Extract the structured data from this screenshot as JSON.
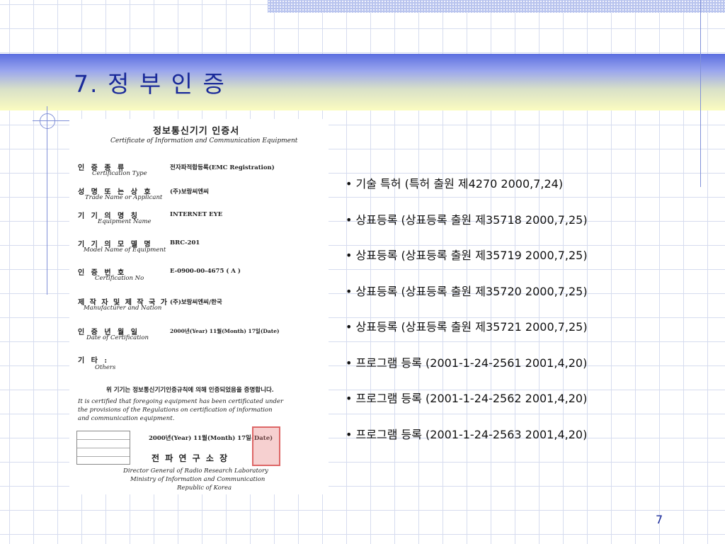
{
  "slide": {
    "title": "7. 정 부 인 증",
    "page_number": "7",
    "bullet": "•",
    "items": [
      "기술 특허 (특허 출원 제4270  2000,7,24)",
      "상표등록 (상표등록 출원 제35718  2000,7,25)",
      "상표등록 (상표등록 출원 제35719  2000,7,25)",
      "상표등록 (상표등록 출원 제35720  2000,7,25)",
      "상표등록 (상표등록 출원 제35721  2000,7,25)",
      "프로그램 등록 (2001-1-24-2561  2001,4,20)",
      "프로그램 등록 (2001-1-24-2562  2001,4,20)",
      "프로그램 등록 (2001-1-24-2563  2001,4,20)"
    ]
  },
  "certificate": {
    "title_ko": "정보통신기기 인증서",
    "title_en": "Certificate of Information and Communication Equipment",
    "rows": [
      {
        "ko": "인  증  종  류",
        "en": "Certification Type",
        "value": "전자파적합등록(EMC Registration)"
      },
      {
        "ko": "성 명 또 는 상 호",
        "en": "Trade Name or Applicant",
        "value": "(주)보랑씨엔씨"
      },
      {
        "ko": "기  기  의  명  칭",
        "en": "Equipment Name",
        "value": "INTERNET EYE"
      },
      {
        "ko": "기 기 의 모 델 명",
        "en": "Model Name of Equipment",
        "value": "BRC-201"
      },
      {
        "ko": "인  증  번  호",
        "en": "Certification No",
        "value": "E-0900-00-4675  ( A )"
      },
      {
        "ko": "제 작 자 및 제 작 국 가",
        "en": "Manufacturer and Nation",
        "value": "(주)보랑씨엔씨/한국"
      },
      {
        "ko": "인  증  년  월  일",
        "en": "Date of Certification",
        "value": "2000년(Year) 11월(Month) 17일(Date)"
      },
      {
        "ko": "기        타 :",
        "en": "Others",
        "value": ""
      }
    ],
    "statement_ko": "위 기기는 정보통신기기인증규칙에 의해 인증되었음을 증명합니다.",
    "statement_en_1": "It is certified that foregoing equipment has been certificated under",
    "statement_en_2": "the provisions of the Regulations on certification of information",
    "statement_en_3": "and communication equipment.",
    "date_line": "2000년(Year)    11월(Month)    17일(Date)",
    "issuer_ko": "전   파   연   구   소   장",
    "issuer_en_1": "Director General of Radio Research Laboratory",
    "issuer_en_2": "Ministry of Information and Communication",
    "issuer_en_3": "Republic of Korea"
  }
}
